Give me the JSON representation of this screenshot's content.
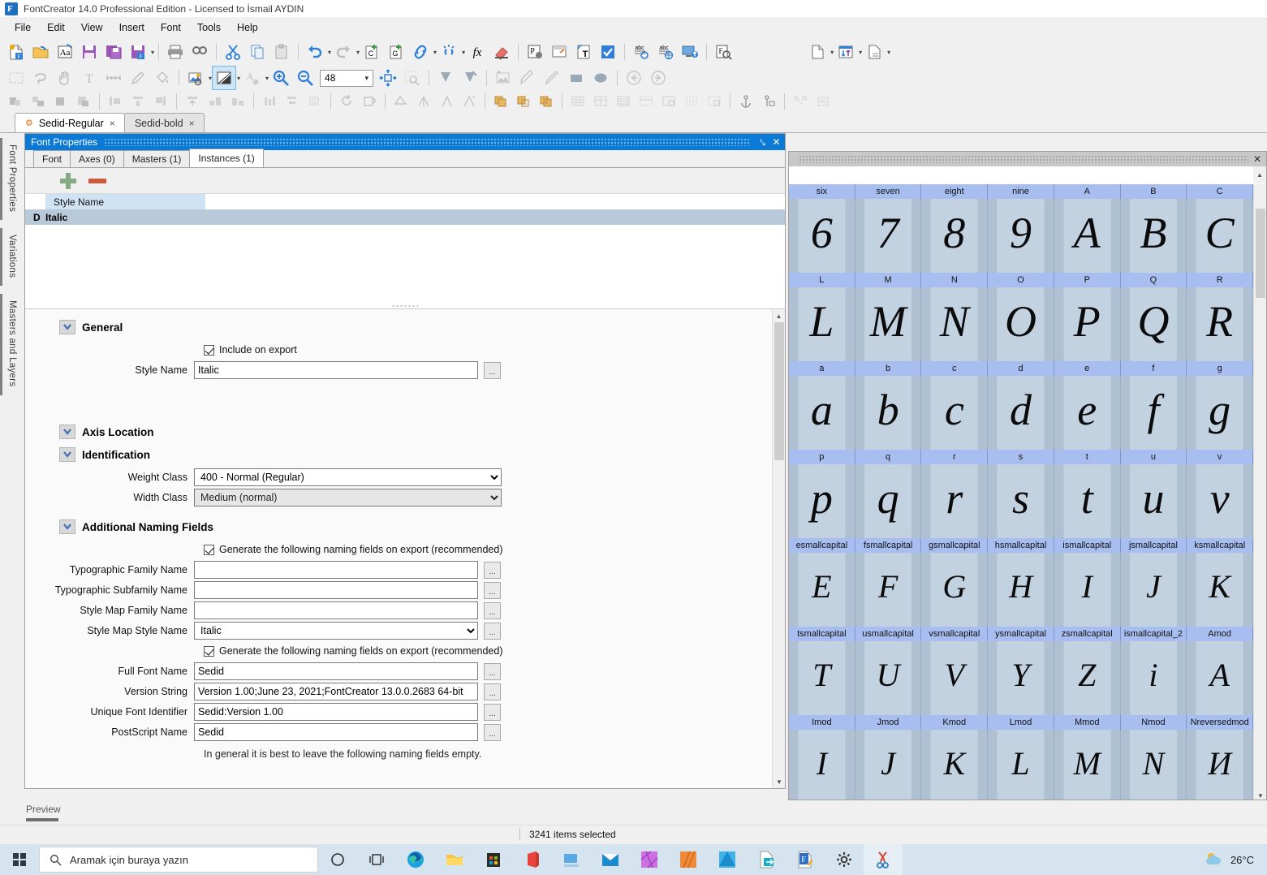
{
  "window": {
    "title": "FontCreator 14.0 Professional Edition - Licensed to İsmail AYDIN",
    "app_icon": "fontcreator-icon"
  },
  "menubar": {
    "items": [
      "File",
      "Edit",
      "View",
      "Insert",
      "Font",
      "Tools",
      "Help"
    ]
  },
  "toolbar": {
    "zoom_value": "48",
    "row1_icons": [
      "new-font-icon",
      "open-font-icon",
      "font-aa-icon",
      "save-icon",
      "save-all-icon",
      "save-as-icon",
      "print-icon",
      "find-icon",
      "cut-icon",
      "copy-icon",
      "paste-icon",
      "undo-icon",
      "redo-icon",
      "add-composite-icon",
      "add-glyph-icon",
      "link-icon",
      "unlink-icon",
      "function-icon",
      "eraser-icon",
      "properties-icon",
      "preview-icon",
      "transform-text-icon",
      "validate-icon",
      "spellcheck-icon",
      "web-font-icon",
      "test-install-icon",
      "font-inspect-icon",
      "new-project-icon",
      "import-export-icon",
      "export-doc-icon"
    ],
    "row2_icons": [
      "select-rect-icon",
      "lasso-icon",
      "hand-icon",
      "text-tool-icon",
      "measure-icon",
      "pen-icon",
      "fill-icon",
      "image-tool-icon",
      "contour-style-icon",
      "glyph-style-icon",
      "zoom-in-icon",
      "zoom-out-icon",
      "fit-icon",
      "magnifier-icon",
      "knife-left-icon",
      "knife-right-icon",
      "insert-image-icon",
      "brush-icon",
      "pencil-icon",
      "rectangle-icon",
      "ellipse-icon",
      "back-icon",
      "forward-icon"
    ],
    "row3_icons": [
      "align-1-icon",
      "align-2-icon",
      "align-3-icon",
      "align-4-icon",
      "dist-1-icon",
      "dist-2-icon",
      "dist-3-icon",
      "top-1-icon",
      "top-2-icon",
      "top-3-icon",
      "bars-1-icon",
      "bars-2-icon",
      "bars-3-icon",
      "rotate-icon",
      "flip-icon",
      "slant-left-icon",
      "mirror-icon",
      "skew-icon",
      "italic-icon",
      "overlap-1-icon",
      "overlap-2-icon",
      "overlap-3-icon",
      "grid-1-icon",
      "grid-2-icon",
      "grid-3-icon",
      "grid-4-icon",
      "grid-5-icon",
      "grid-6-icon",
      "grid-7-icon",
      "anchor-icon",
      "anchor-lock-icon",
      "branch-icon",
      "table-icon"
    ]
  },
  "doc_tabs": [
    {
      "label": "Sedid-Regular",
      "selected": true,
      "close": "×",
      "icon": "gear-icon"
    },
    {
      "label": "Sedid-bold",
      "selected": false,
      "close": "×"
    }
  ],
  "left_strip": {
    "tabs": [
      "Font Properties",
      "Variations",
      "Masters and Layers"
    ]
  },
  "font_properties": {
    "panel_title": "Font Properties",
    "pin_icon": "pin-icon",
    "close_icon": "close-icon",
    "tabs": [
      {
        "label": "Font",
        "selected": false
      },
      {
        "label": "Axes (0)",
        "selected": false
      },
      {
        "label": "Masters (1)",
        "selected": false
      },
      {
        "label": "Instances (1)",
        "selected": true
      }
    ],
    "instance_toolbar": {
      "add": "add-instance-icon",
      "remove": "remove-instance-icon"
    },
    "instances_grid": {
      "columns": [
        "Style Name"
      ],
      "rows": [
        {
          "flag": "D",
          "style_name": "Italic"
        }
      ]
    },
    "sections": {
      "general": {
        "title": "General",
        "include_on_export": {
          "label": "Include on export",
          "checked": true
        },
        "style_name": {
          "label": "Style Name",
          "value": "Italic",
          "ell": "..."
        }
      },
      "axis_location": {
        "title": "Axis Location"
      },
      "identification": {
        "title": "Identification",
        "weight_class": {
          "label": "Weight Class",
          "value": "400 - Normal (Regular)"
        },
        "width_class": {
          "label": "Width Class",
          "value": "Medium (normal)"
        }
      },
      "additional_naming": {
        "title": "Additional Naming Fields",
        "generate_1": {
          "label": "Generate the following naming fields on export (recommended)",
          "checked": true
        },
        "typographic_family_name": {
          "label": "Typographic Family Name",
          "value": "",
          "ell": "..."
        },
        "typographic_subfamily_name": {
          "label": "Typographic Subfamily Name",
          "value": "",
          "ell": "..."
        },
        "style_map_family_name": {
          "label": "Style Map Family Name",
          "value": "",
          "ell": "..."
        },
        "style_map_style_name": {
          "label": "Style Map Style Name",
          "value": "Italic",
          "ell": "..."
        },
        "generate_2": {
          "label": "Generate the following naming fields on export (recommended)",
          "checked": true
        },
        "full_font_name": {
          "label": "Full Font Name",
          "value": "Sedid",
          "ell": "..."
        },
        "version_string": {
          "label": "Version String",
          "value": "Version 1.00;June 23, 2021;FontCreator 13.0.0.2683 64-bit",
          "ell": "..."
        },
        "unique_font_identifier": {
          "label": "Unique Font Identifier",
          "value": "Sedid:Version 1.00",
          "ell": "..."
        },
        "postscript_name": {
          "label": "PostScript Name",
          "value": "Sedid",
          "ell": "..."
        },
        "footer_hint": "In general it is best to leave the following naming fields empty."
      }
    }
  },
  "glyph_panel": {
    "close_icon": "close-icon",
    "rows": [
      {
        "names": [
          "six",
          "seven",
          "eight",
          "nine",
          "A",
          "B",
          "C"
        ],
        "glyphs": [
          "6",
          "7",
          "8",
          "9",
          "A",
          "B",
          "C"
        ],
        "small": false
      },
      {
        "names": [
          "L",
          "M",
          "N",
          "O",
          "P",
          "Q",
          "R"
        ],
        "glyphs": [
          "L",
          "M",
          "N",
          "O",
          "P",
          "Q",
          "R"
        ],
        "small": false
      },
      {
        "names": [
          "a",
          "b",
          "c",
          "d",
          "e",
          "f",
          "g"
        ],
        "glyphs": [
          "a",
          "b",
          "c",
          "d",
          "e",
          "f",
          "g"
        ],
        "small": false
      },
      {
        "names": [
          "p",
          "q",
          "r",
          "s",
          "t",
          "u",
          "v"
        ],
        "glyphs": [
          "p",
          "q",
          "r",
          "s",
          "t",
          "u",
          "v"
        ],
        "small": false
      },
      {
        "names": [
          "esmallcapital",
          "fsmallcapital",
          "gsmallcapital",
          "hsmallcapital",
          "ismallcapital",
          "jsmallcapital",
          "ksmallcapital"
        ],
        "glyphs": [
          "E",
          "F",
          "G",
          "H",
          "I",
          "J",
          "K"
        ],
        "small": true
      },
      {
        "names": [
          "tsmallcapital",
          "usmallcapital",
          "vsmallcapital",
          "ysmallcapital",
          "zsmallcapital",
          "ismallcapital_2",
          "Amod"
        ],
        "glyphs": [
          "T",
          "U",
          "V",
          "Y",
          "Z",
          "i",
          "A"
        ],
        "small": true
      },
      {
        "names": [
          "Imod",
          "Jmod",
          "Kmod",
          "Lmod",
          "Mmod",
          "Nmod",
          "Nreversedmod"
        ],
        "glyphs": [
          "I",
          "J",
          "K",
          "L",
          "M",
          "N",
          "И"
        ],
        "small": true
      }
    ]
  },
  "preview_bar": {
    "label": "Preview"
  },
  "status_bar": {
    "text": "3241 items selected"
  },
  "taskbar": {
    "search_placeholder": "Aramak için buraya yazın",
    "search_icon": "search-icon",
    "start_icon": "windows-start-icon",
    "icons": [
      "cortana-icon",
      "task-view-icon",
      "edge-icon",
      "file-explorer-icon",
      "microsoft-store-icon",
      "office-icon",
      "remote-desktop-icon",
      "mail-icon",
      "affinity-photo-icon",
      "affinity-publisher-icon",
      "affinity-designer-icon",
      "file-converter-icon",
      "fontcreator-icon",
      "settings-icon",
      "snipping-tool-icon"
    ],
    "weather": {
      "temp": "26°C",
      "icon": "partly-cloudy-icon"
    }
  }
}
